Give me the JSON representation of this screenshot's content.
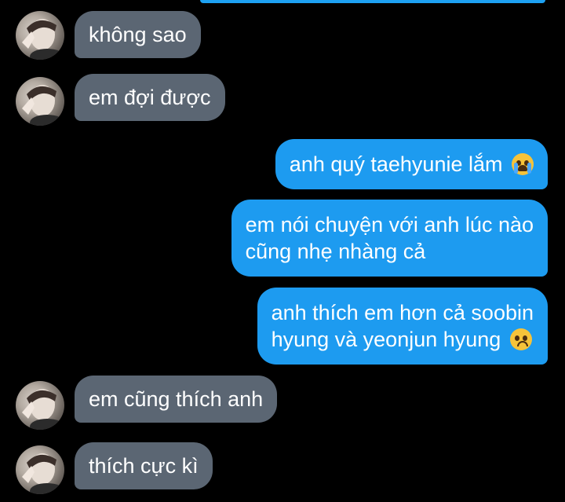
{
  "messages": [
    {
      "side": "in",
      "text": "không sao",
      "emoji": ""
    },
    {
      "side": "in",
      "text": "em đợi được",
      "emoji": ""
    },
    {
      "side": "out",
      "text": "anh quý taehyunie lắm",
      "emoji": "loudly-crying-face"
    },
    {
      "side": "out",
      "line1": "em nói chuyện với anh lúc nào",
      "line2": "cũng nhẹ nhàng cả",
      "emoji": ""
    },
    {
      "side": "out",
      "line1": "anh thích em hơn cả soobin",
      "line2": "hyung và yeonjun hyung",
      "emoji": "pleading-face"
    },
    {
      "side": "in",
      "text": "em cũng thích anh",
      "emoji": ""
    },
    {
      "side": "in",
      "text": "thích cực kì",
      "emoji": ""
    }
  ],
  "colors": {
    "background": "#000000",
    "incoming_bubble": "#5b6673",
    "outgoing_bubble": "#1d9bf0",
    "text": "#ffffff"
  }
}
